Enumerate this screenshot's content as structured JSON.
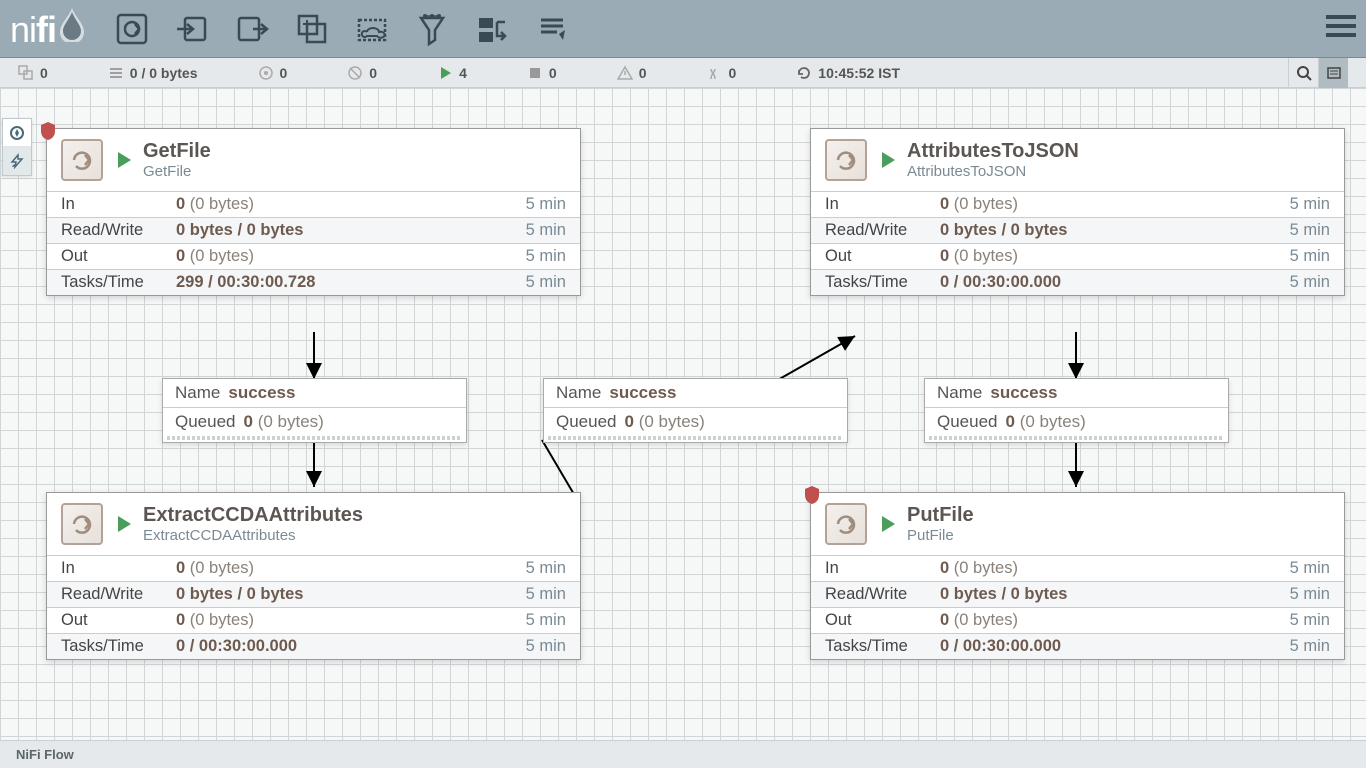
{
  "logo": {
    "text1": "ni",
    "text2": "fi"
  },
  "status": {
    "groups": "0",
    "queued": "0 / 0 bytes",
    "transmitting": "0",
    "not_transmitting": "0",
    "running": "4",
    "stopped": "0",
    "invalid": "0",
    "disabled": "0",
    "refresh": "10:45:52 IST"
  },
  "processors": {
    "getfile": {
      "title": "GetFile",
      "subtitle": "GetFile",
      "in_v": "0",
      "in_b": "(0 bytes)",
      "rw": "0 bytes / 0 bytes",
      "out_v": "0",
      "out_b": "(0 bytes)",
      "tt": "299 / 00:30:00.728",
      "time": "5 min",
      "has_out": false
    },
    "extract": {
      "title": "ExtractCCDAAttributes",
      "subtitle": "ExtractCCDAAttributes",
      "in_v": "0",
      "in_b": "(0 bytes)",
      "rw": "0 bytes / 0 bytes",
      "out_v": "0",
      "out_b": "(0 bytes)",
      "tt": "0 / 00:30:00.000",
      "time": "5 min",
      "has_out": true
    },
    "attrjson": {
      "title": "AttributesToJSON",
      "subtitle": "AttributesToJSON",
      "in_v": "0",
      "in_b": "(0 bytes)",
      "rw": "0 bytes / 0 bytes",
      "out_v": "0",
      "out_b": "(0 bytes)",
      "tt": "0 / 00:30:00.000",
      "time": "5 min",
      "has_out": true
    },
    "putfile": {
      "title": "PutFile",
      "subtitle": "PutFile",
      "in_v": "0",
      "in_b": "(0 bytes)",
      "rw": "0 bytes / 0 bytes",
      "out_v": "0",
      "out_b": "(0 bytes)",
      "tt": "0 / 00:30:00.000",
      "time": "5 min",
      "has_out": true
    }
  },
  "labels": {
    "in": "In",
    "rw": "Read/Write",
    "out": "Out",
    "tt": "Tasks/Time",
    "name": "Name",
    "queued": "Queued"
  },
  "connections": {
    "c1": {
      "name": "success",
      "q_v": "0",
      "q_b": "(0 bytes)"
    },
    "c2": {
      "name": "success",
      "q_v": "0",
      "q_b": "(0 bytes)"
    },
    "c3": {
      "name": "success",
      "q_v": "0",
      "q_b": "(0 bytes)"
    }
  },
  "footer": "NiFi Flow"
}
